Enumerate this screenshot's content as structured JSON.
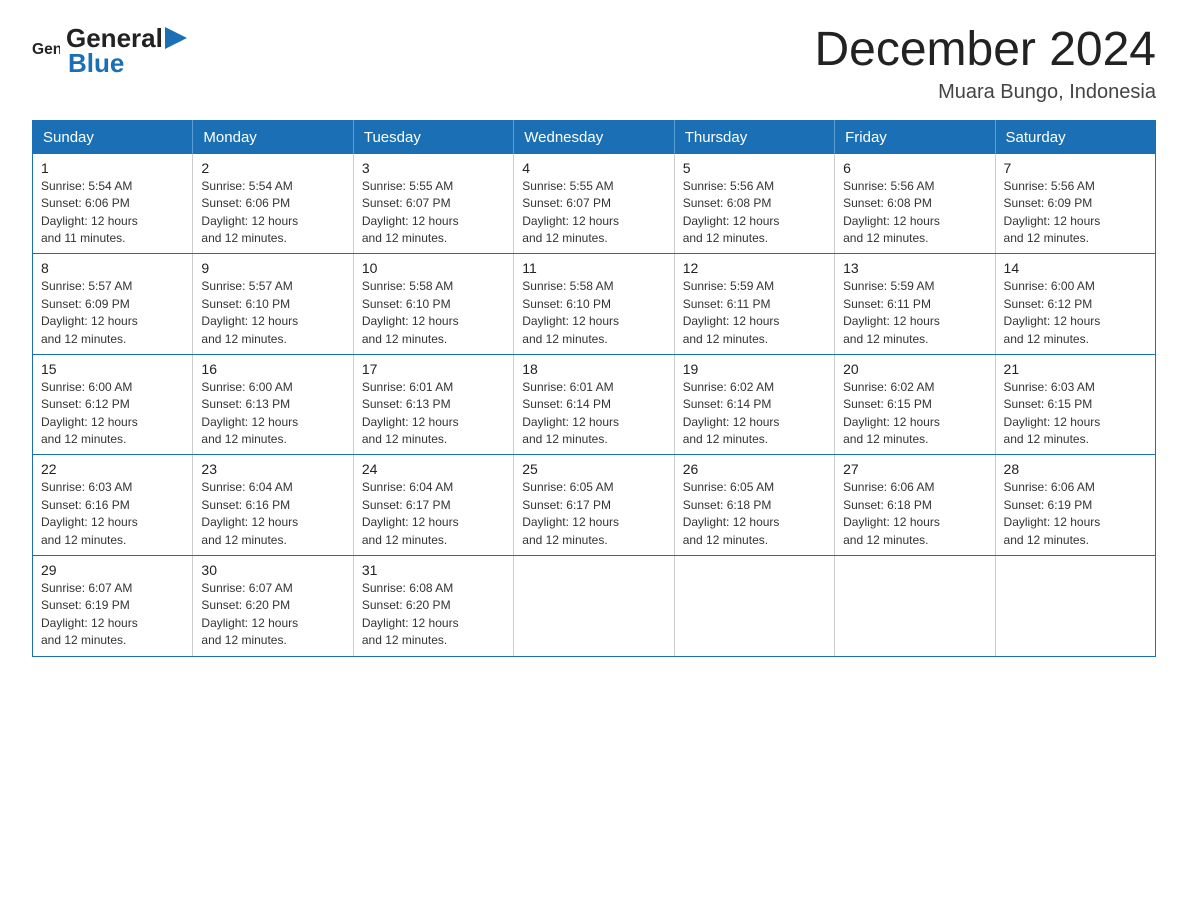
{
  "logo": {
    "text_general": "General",
    "text_blue": "Blue"
  },
  "header": {
    "title": "December 2024",
    "subtitle": "Muara Bungo, Indonesia"
  },
  "calendar": {
    "days_of_week": [
      "Sunday",
      "Monday",
      "Tuesday",
      "Wednesday",
      "Thursday",
      "Friday",
      "Saturday"
    ],
    "weeks": [
      [
        {
          "day": "1",
          "sunrise": "5:54 AM",
          "sunset": "6:06 PM",
          "daylight": "12 hours and 11 minutes."
        },
        {
          "day": "2",
          "sunrise": "5:54 AM",
          "sunset": "6:06 PM",
          "daylight": "12 hours and 12 minutes."
        },
        {
          "day": "3",
          "sunrise": "5:55 AM",
          "sunset": "6:07 PM",
          "daylight": "12 hours and 12 minutes."
        },
        {
          "day": "4",
          "sunrise": "5:55 AM",
          "sunset": "6:07 PM",
          "daylight": "12 hours and 12 minutes."
        },
        {
          "day": "5",
          "sunrise": "5:56 AM",
          "sunset": "6:08 PM",
          "daylight": "12 hours and 12 minutes."
        },
        {
          "day": "6",
          "sunrise": "5:56 AM",
          "sunset": "6:08 PM",
          "daylight": "12 hours and 12 minutes."
        },
        {
          "day": "7",
          "sunrise": "5:56 AM",
          "sunset": "6:09 PM",
          "daylight": "12 hours and 12 minutes."
        }
      ],
      [
        {
          "day": "8",
          "sunrise": "5:57 AM",
          "sunset": "6:09 PM",
          "daylight": "12 hours and 12 minutes."
        },
        {
          "day": "9",
          "sunrise": "5:57 AM",
          "sunset": "6:10 PM",
          "daylight": "12 hours and 12 minutes."
        },
        {
          "day": "10",
          "sunrise": "5:58 AM",
          "sunset": "6:10 PM",
          "daylight": "12 hours and 12 minutes."
        },
        {
          "day": "11",
          "sunrise": "5:58 AM",
          "sunset": "6:10 PM",
          "daylight": "12 hours and 12 minutes."
        },
        {
          "day": "12",
          "sunrise": "5:59 AM",
          "sunset": "6:11 PM",
          "daylight": "12 hours and 12 minutes."
        },
        {
          "day": "13",
          "sunrise": "5:59 AM",
          "sunset": "6:11 PM",
          "daylight": "12 hours and 12 minutes."
        },
        {
          "day": "14",
          "sunrise": "6:00 AM",
          "sunset": "6:12 PM",
          "daylight": "12 hours and 12 minutes."
        }
      ],
      [
        {
          "day": "15",
          "sunrise": "6:00 AM",
          "sunset": "6:12 PM",
          "daylight": "12 hours and 12 minutes."
        },
        {
          "day": "16",
          "sunrise": "6:00 AM",
          "sunset": "6:13 PM",
          "daylight": "12 hours and 12 minutes."
        },
        {
          "day": "17",
          "sunrise": "6:01 AM",
          "sunset": "6:13 PM",
          "daylight": "12 hours and 12 minutes."
        },
        {
          "day": "18",
          "sunrise": "6:01 AM",
          "sunset": "6:14 PM",
          "daylight": "12 hours and 12 minutes."
        },
        {
          "day": "19",
          "sunrise": "6:02 AM",
          "sunset": "6:14 PM",
          "daylight": "12 hours and 12 minutes."
        },
        {
          "day": "20",
          "sunrise": "6:02 AM",
          "sunset": "6:15 PM",
          "daylight": "12 hours and 12 minutes."
        },
        {
          "day": "21",
          "sunrise": "6:03 AM",
          "sunset": "6:15 PM",
          "daylight": "12 hours and 12 minutes."
        }
      ],
      [
        {
          "day": "22",
          "sunrise": "6:03 AM",
          "sunset": "6:16 PM",
          "daylight": "12 hours and 12 minutes."
        },
        {
          "day": "23",
          "sunrise": "6:04 AM",
          "sunset": "6:16 PM",
          "daylight": "12 hours and 12 minutes."
        },
        {
          "day": "24",
          "sunrise": "6:04 AM",
          "sunset": "6:17 PM",
          "daylight": "12 hours and 12 minutes."
        },
        {
          "day": "25",
          "sunrise": "6:05 AM",
          "sunset": "6:17 PM",
          "daylight": "12 hours and 12 minutes."
        },
        {
          "day": "26",
          "sunrise": "6:05 AM",
          "sunset": "6:18 PM",
          "daylight": "12 hours and 12 minutes."
        },
        {
          "day": "27",
          "sunrise": "6:06 AM",
          "sunset": "6:18 PM",
          "daylight": "12 hours and 12 minutes."
        },
        {
          "day": "28",
          "sunrise": "6:06 AM",
          "sunset": "6:19 PM",
          "daylight": "12 hours and 12 minutes."
        }
      ],
      [
        {
          "day": "29",
          "sunrise": "6:07 AM",
          "sunset": "6:19 PM",
          "daylight": "12 hours and 12 minutes."
        },
        {
          "day": "30",
          "sunrise": "6:07 AM",
          "sunset": "6:20 PM",
          "daylight": "12 hours and 12 minutes."
        },
        {
          "day": "31",
          "sunrise": "6:08 AM",
          "sunset": "6:20 PM",
          "daylight": "12 hours and 12 minutes."
        },
        null,
        null,
        null,
        null
      ]
    ],
    "labels": {
      "sunrise": "Sunrise:",
      "sunset": "Sunset:",
      "daylight": "Daylight:"
    }
  }
}
